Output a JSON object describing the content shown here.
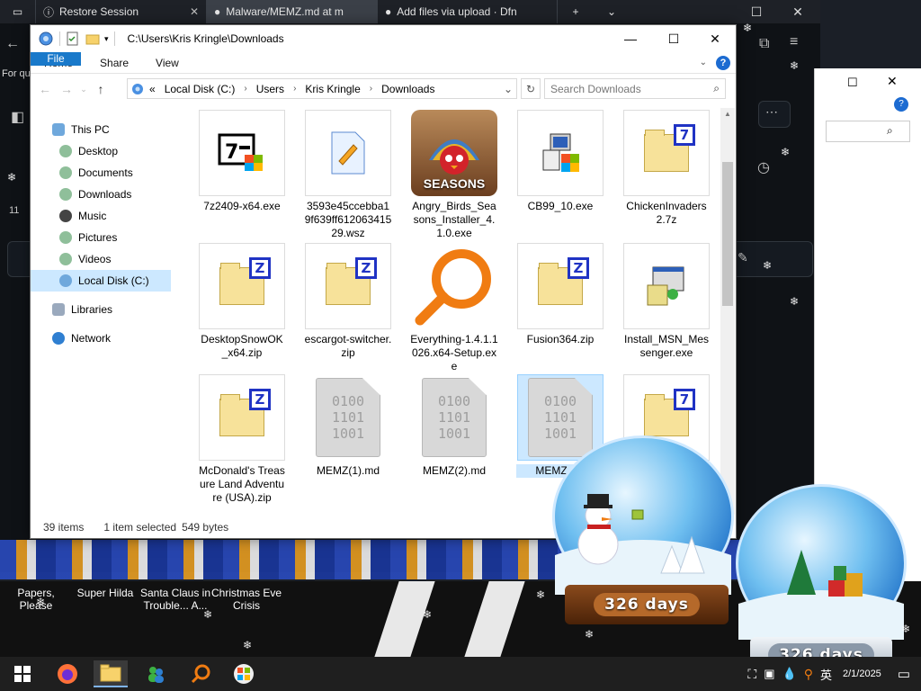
{
  "browser": {
    "tabs": [
      {
        "label": "Restore Session"
      },
      {
        "label": "Malware/MEMZ.md at m"
      },
      {
        "label": "Add files via upload · Dfn"
      }
    ],
    "for_quick_label": "For qu",
    "row_number": "11"
  },
  "explorer": {
    "title": "C:\\Users\\Kris Kringle\\Downloads",
    "ribbon_tabs": [
      "File",
      "Home",
      "Share",
      "View"
    ],
    "address_crumbs": [
      "Local Disk (C:)",
      "Users",
      "Kris Kringle",
      "Downloads"
    ],
    "address_prefix": "«",
    "search_placeholder": "Search Downloads",
    "nav": [
      {
        "label": "This PC",
        "icon": "this-pc-icon"
      },
      {
        "label": "Desktop",
        "icon": "desktop-folder-icon"
      },
      {
        "label": "Documents",
        "icon": "documents-folder-icon"
      },
      {
        "label": "Downloads",
        "icon": "downloads-folder-icon"
      },
      {
        "label": "Music",
        "icon": "music-folder-icon"
      },
      {
        "label": "Pictures",
        "icon": "pictures-folder-icon"
      },
      {
        "label": "Videos",
        "icon": "videos-folder-icon"
      },
      {
        "label": "Local Disk (C:)",
        "icon": "local-disk-icon"
      },
      {
        "label": "Libraries",
        "icon": "libraries-icon"
      },
      {
        "label": "Network",
        "icon": "network-icon"
      }
    ],
    "files": [
      {
        "name": "7z2409-x64.exe",
        "kind": "exe-7z"
      },
      {
        "name": "3593e45ccebba19f639ff61206341529.wsz",
        "kind": "wsz"
      },
      {
        "name": "Angry_Birds_Seasons_Installer_4.1.0.exe",
        "kind": "angry-birds",
        "badge": "SEASONS"
      },
      {
        "name": "CB99_10.exe",
        "kind": "installer"
      },
      {
        "name": "ChickenInvaders2.7z",
        "kind": "7z"
      },
      {
        "name": "DesktopSnowOK_x64.zip",
        "kind": "zip"
      },
      {
        "name": "escargot-switcher.zip",
        "kind": "zip"
      },
      {
        "name": "Everything-1.4.1.1026.x64-Setup.exe",
        "kind": "everything"
      },
      {
        "name": "Fusion364.zip",
        "kind": "zip"
      },
      {
        "name": "Install_MSN_Messenger.exe",
        "kind": "installer"
      },
      {
        "name": "McDonald's Treasure Land Adventure (USA).zip",
        "kind": "zip"
      },
      {
        "name": "MEMZ(1).md",
        "kind": "md"
      },
      {
        "name": "MEMZ(2).md",
        "kind": "md"
      },
      {
        "name": "MEMZ.md",
        "kind": "md",
        "selected": true
      },
      {
        "name": "",
        "kind": "7z"
      }
    ],
    "binary_lines": [
      "0100",
      "1101",
      "1001"
    ],
    "status": {
      "item_count": "39 items",
      "selected": "1 item selected",
      "size": "549 bytes"
    }
  },
  "desktop": {
    "labels": [
      "Papers, Please",
      "Super Hilda",
      "Santa Claus in Trouble... A...",
      "Christmas Eve Crisis"
    ]
  },
  "globes": [
    {
      "days": "326 days"
    },
    {
      "days": "326 days"
    }
  ],
  "taskbar": {
    "date": "2/1/2025",
    "ime": "英"
  },
  "colors": {
    "ribbon_file": "#1979ca",
    "selection": "#cce8ff",
    "taskbar": "#1f1f1f"
  }
}
